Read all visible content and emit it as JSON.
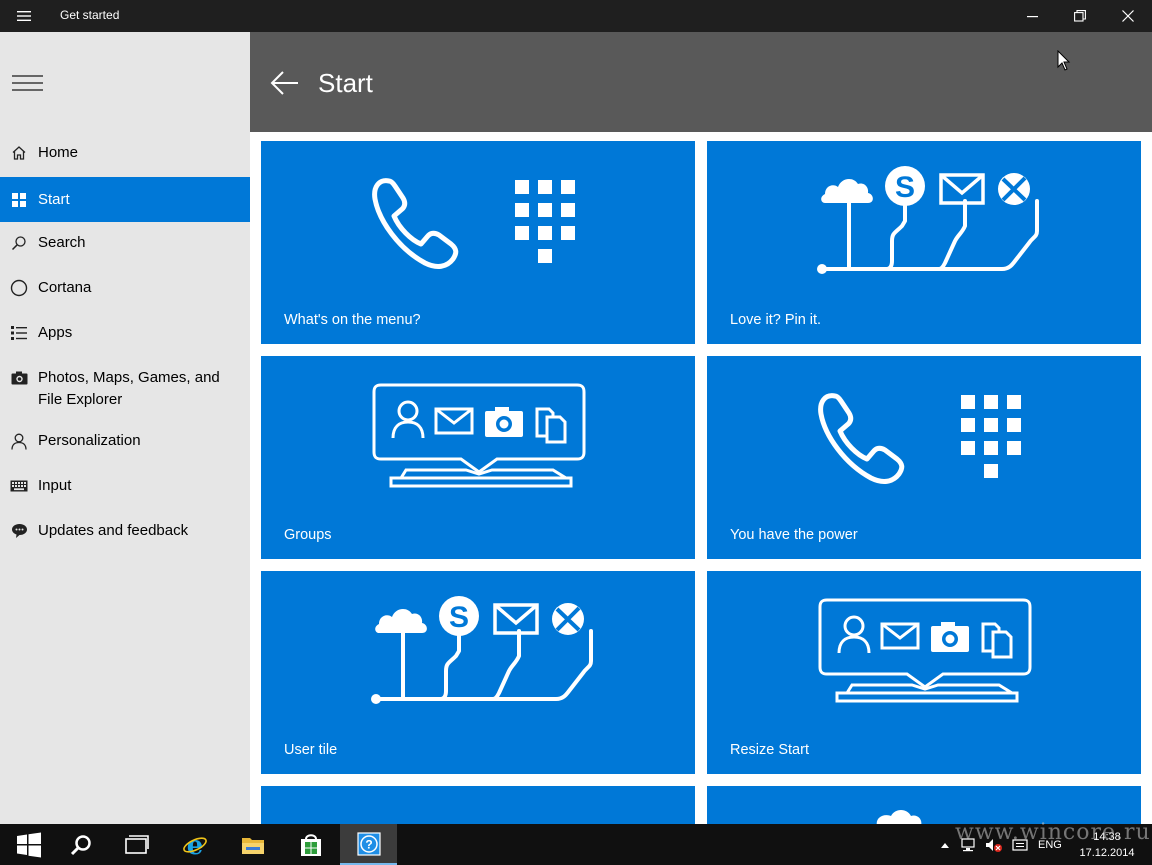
{
  "window": {
    "title": "Get started",
    "menu_icon": "hamburger-icon",
    "minimize_icon": "minimize-icon",
    "maximize_icon": "restore-icon",
    "close_icon": "close-icon"
  },
  "sidebar": {
    "items": [
      {
        "label": "Home",
        "icon": "home-icon"
      },
      {
        "label": "Start",
        "icon": "start-tiles-icon",
        "active": true
      },
      {
        "label": "Search",
        "icon": "search-icon"
      },
      {
        "label": "Cortana",
        "icon": "cortana-circle-icon"
      },
      {
        "label": "Apps",
        "icon": "apps-list-icon"
      },
      {
        "label": "Photos, Maps, Games, and File Explorer",
        "icon": "camera-icon"
      },
      {
        "label": "Personalization",
        "icon": "person-icon"
      },
      {
        "label": "Input",
        "icon": "keyboard-icon"
      },
      {
        "label": "Updates and feedback",
        "icon": "feedback-icon"
      }
    ]
  },
  "header": {
    "title": "Start",
    "back_icon": "back-arrow-icon"
  },
  "tiles": [
    {
      "caption": "What's on the menu?",
      "art": "phone-dialpad"
    },
    {
      "caption": "Love it? Pin it.",
      "art": "apps-tree"
    },
    {
      "caption": "Groups",
      "art": "tablet-bubble"
    },
    {
      "caption": "You have the power",
      "art": "phone-dialpad"
    },
    {
      "caption": "User tile",
      "art": "apps-tree"
    },
    {
      "caption": "Resize Start",
      "art": "tablet-bubble"
    }
  ],
  "taskbar": {
    "items": [
      "windows-start-icon",
      "search-icon",
      "task-view-icon",
      "internet-explorer-icon",
      "file-explorer-icon",
      "store-icon",
      "get-started-icon"
    ],
    "active_item": "get-started-icon",
    "tray": {
      "language": "ENG",
      "time": "14:38",
      "date": "17.12.2014"
    }
  },
  "watermark": "www.wincore.ru",
  "colors": {
    "accent": "#0078d7",
    "header": "#595959",
    "sidebar": "#e6e6e6",
    "titlebar": "#1f1f1f",
    "taskbar": "#101010"
  }
}
